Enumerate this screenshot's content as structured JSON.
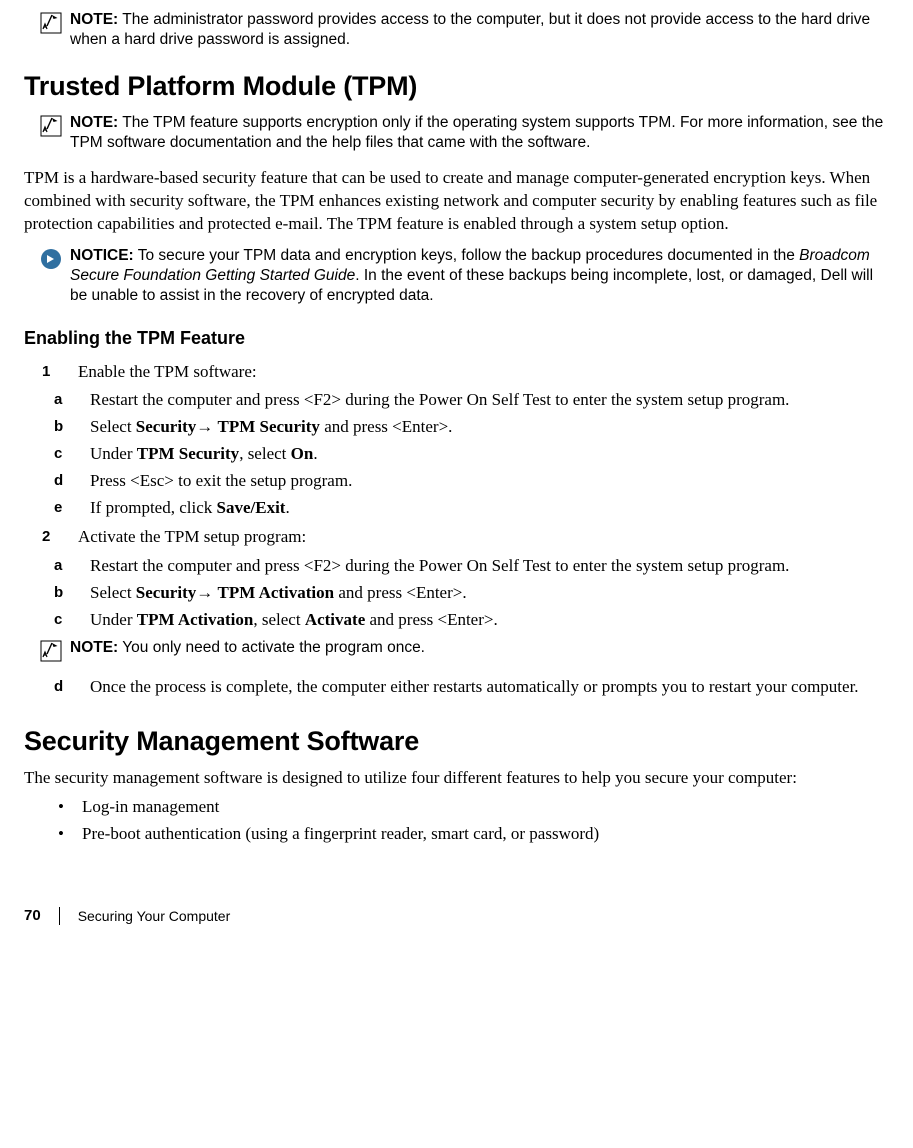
{
  "notes": {
    "top": {
      "label": "NOTE:",
      "text": "The administrator password provides access to the computer, but it does not provide access to the hard drive when a hard drive password is assigned."
    },
    "tpm_support": {
      "label": "NOTE:",
      "text": "The TPM feature supports encryption only if the operating system supports TPM. For more information, see the TPM software documentation and the help files that came with the software."
    },
    "notice_backup": {
      "label": "NOTICE:",
      "pre": "To secure your TPM data and encryption keys, follow the backup procedures documented in the ",
      "italic": "Broadcom Secure Foundation Getting Started Guide",
      "post": ". In the event of these backups being incomplete, lost, or damaged, Dell will be unable to assist in the recovery of encrypted data."
    },
    "activate_once": {
      "label": "NOTE:",
      "text": "You only need to activate the program once."
    }
  },
  "h1_tpm": "Trusted Platform Module (TPM)",
  "tpm_body": "TPM is a hardware-based security feature that can be used to create and manage computer-generated encryption keys. When combined with security software, the TPM enhances existing network and computer security by enabling features such as file protection capabilities and protected e-mail. The TPM feature is enabled through a system setup option.",
  "h2_enable": "Enabling the TPM Feature",
  "steps": {
    "s1": {
      "mark": "1",
      "text": "Enable the TPM software:",
      "subs": {
        "a": {
          "mark": "a",
          "text": "Restart the computer and press <F2> during the Power On Self Test to enter the system setup program."
        },
        "b": {
          "mark": "b",
          "pre": "Select ",
          "bold1": "Security",
          "arrow": "→ ",
          "bold2": "TPM Security",
          "post": " and press <Enter>."
        },
        "c": {
          "mark": "c",
          "pre": "Under ",
          "bold1": "TPM Security",
          "mid": ", select ",
          "bold2": "On",
          "post": "."
        },
        "d": {
          "mark": "d",
          "text": "Press <Esc> to exit the setup program."
        },
        "e": {
          "mark": "e",
          "pre": "If prompted, click ",
          "bold1": "Save/Exit",
          "post": "."
        }
      }
    },
    "s2": {
      "mark": "2",
      "text": "Activate the TPM setup program:",
      "subs": {
        "a": {
          "mark": "a",
          "text": "Restart the computer and press <F2> during the Power On Self Test to enter the system setup program."
        },
        "b": {
          "mark": "b",
          "pre": "Select ",
          "bold1": "Security",
          "arrow": "→ ",
          "bold2": "TPM Activation",
          "post": " and press <Enter>."
        },
        "c": {
          "mark": "c",
          "pre": "Under ",
          "bold1": "TPM Activation",
          "mid": ", select ",
          "bold2": "Activate",
          "post": " and press <Enter>."
        },
        "d": {
          "mark": "d",
          "text": "Once the process is complete, the computer either restarts automatically or prompts you to restart your computer."
        }
      }
    }
  },
  "h1_sms": "Security Management Software",
  "sms_body": "The security management software is designed to utilize four different features to help you secure your computer:",
  "bullets": {
    "b1": "Log-in management",
    "b2": "Pre-boot authentication (using a fingerprint reader, smart card, or password)"
  },
  "footer": {
    "page": "70",
    "title": "Securing Your Computer"
  },
  "glyphs": {
    "bullet": "•"
  }
}
